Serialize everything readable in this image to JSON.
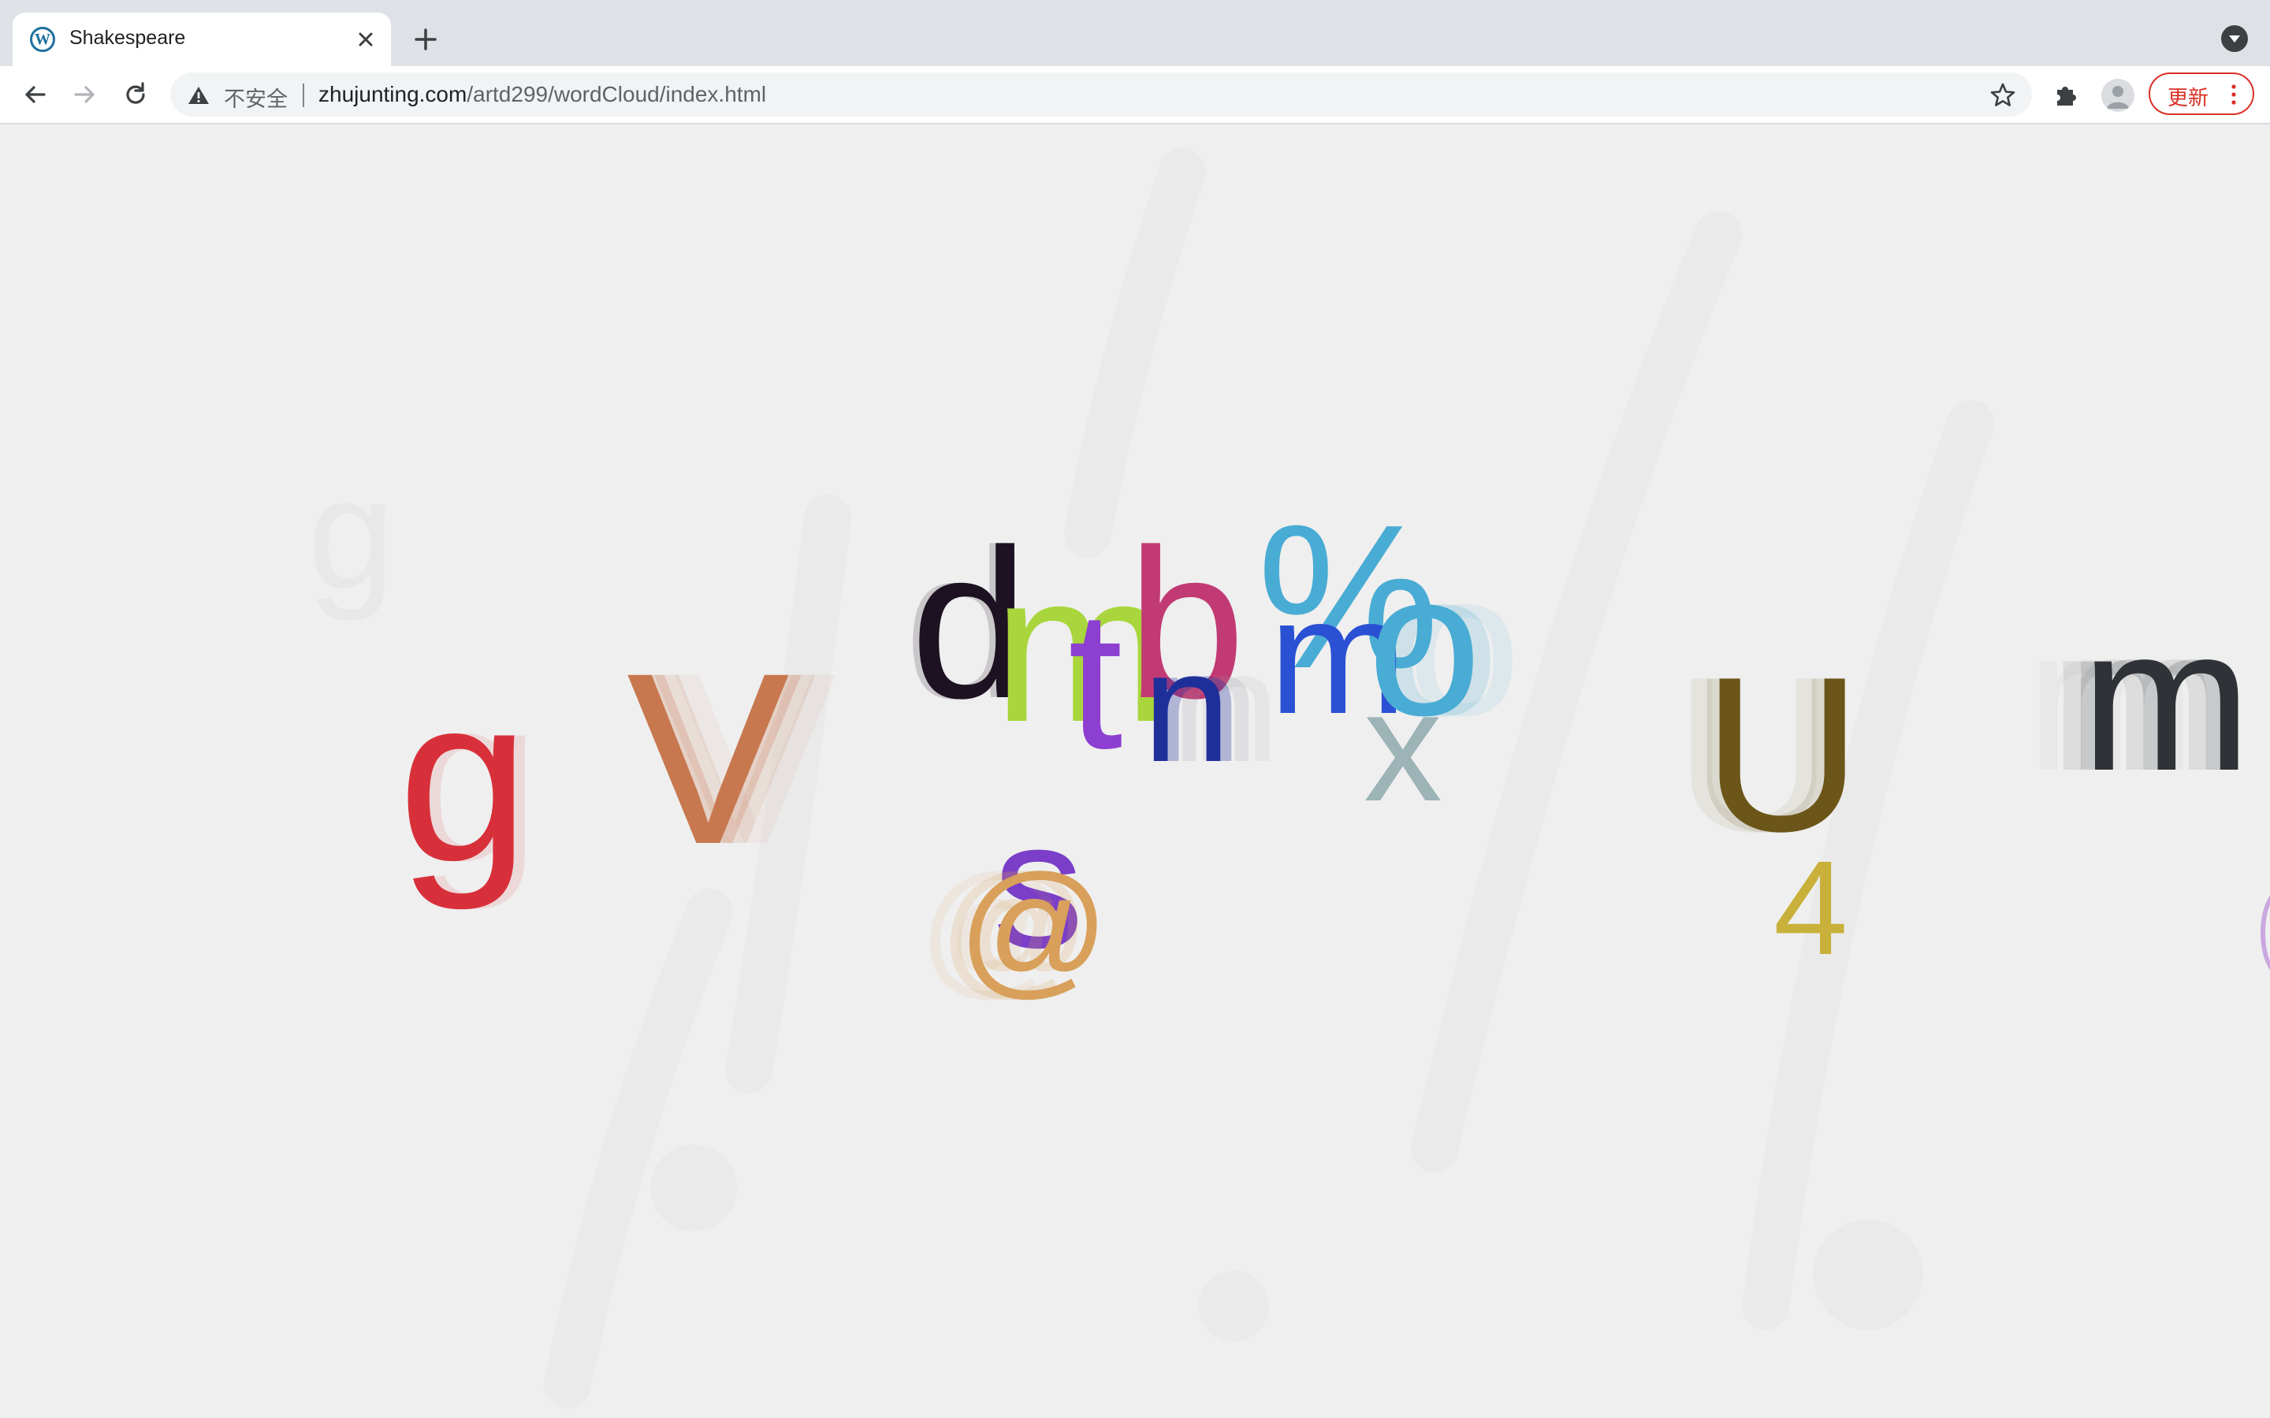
{
  "browser": {
    "tab": {
      "title": "Shakespeare",
      "favicon": "wordpress-icon"
    },
    "address_bar": {
      "security_label": "不安全",
      "url_host": "zhujunting.com",
      "url_path": "/artd299/wordCloud/index.html"
    },
    "update_button": {
      "label": "更新"
    }
  },
  "colors": {
    "page_background": "#efefef",
    "update_accent": "#d93025"
  },
  "word_cloud": {
    "letters": [
      {
        "char": "g",
        "color": "#d8303a"
      },
      {
        "char": "V",
        "color": "#c8784f"
      },
      {
        "char": "d",
        "color": "#1c1222"
      },
      {
        "char": "m",
        "color": "#a8d63c"
      },
      {
        "char": "b",
        "color": "#c23a74"
      },
      {
        "char": "t",
        "color": "#8c3fd0"
      },
      {
        "char": "n",
        "color": "#1f2f9a"
      },
      {
        "char": "%",
        "color": "#49acd4"
      },
      {
        "char": "m",
        "color": "#2a50d4"
      },
      {
        "char": "o",
        "color": "#49acd4"
      },
      {
        "char": "x",
        "color": "#9cb4b6"
      },
      {
        "char": "s",
        "color": "#7a3ec8"
      },
      {
        "char": "@",
        "color": "#d8a05a"
      },
      {
        "char": "U",
        "color": "#6b5518"
      },
      {
        "char": "4",
        "color": "#c9b03a"
      },
      {
        "char": "m",
        "color": "#2f3236"
      }
    ]
  }
}
